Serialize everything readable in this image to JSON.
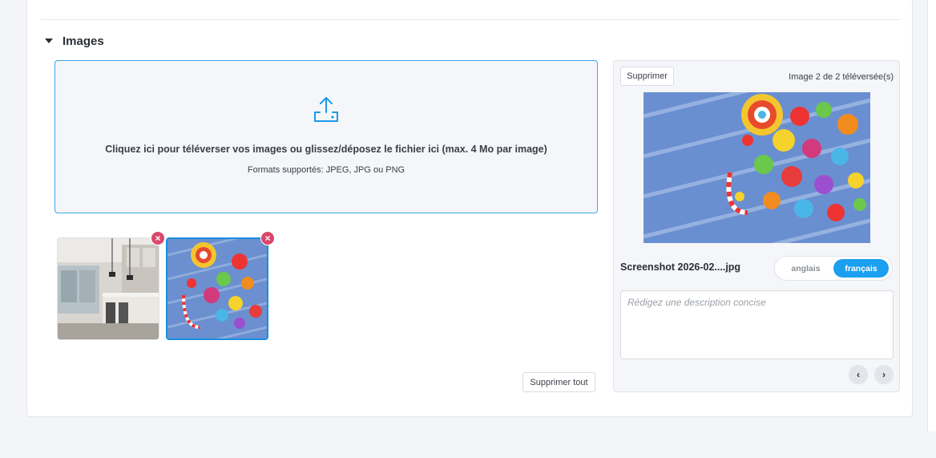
{
  "section": {
    "title": "Images"
  },
  "dropzone": {
    "main_text": "Cliquez ici pour téléverser vos images ou glissez/déposez le fichier ici (max. 4 Mo par image)",
    "formats_text": "Formats supportés: JPEG, JPG ou PNG",
    "icon": "upload-icon"
  },
  "thumbnails": [
    {
      "name": "kitchen-photo",
      "selected": false
    },
    {
      "name": "candy-photo",
      "selected": true
    }
  ],
  "remove_icon_glyph": "×",
  "actions": {
    "delete_all_label": "Supprimer tout"
  },
  "detail": {
    "delete_label": "Supprimer",
    "counter_text": "Image 2 de 2 téléversée(s)",
    "filename": "Screenshot 2026-02....jpg",
    "languages": [
      {
        "label": "anglais",
        "active": false
      },
      {
        "label": "français",
        "active": true
      }
    ],
    "description_placeholder": "Rédigez une description concise",
    "description_value": "",
    "prev_icon": "chevron-left-icon",
    "next_icon": "chevron-right-icon",
    "prev_glyph": "‹",
    "next_glyph": "›"
  },
  "colors": {
    "accent": "#1aa0ef",
    "dropzone_border": "#3ea6e6",
    "remove_badge": "#d9476b",
    "selected_border": "#1a8fe0"
  }
}
